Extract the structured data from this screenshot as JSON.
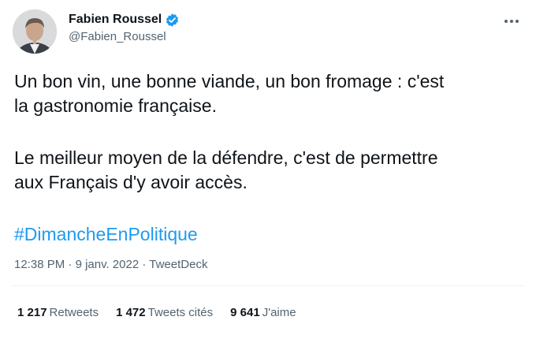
{
  "author": {
    "display_name": "Fabien Roussel",
    "handle": "@Fabien_Roussel",
    "verified": true,
    "verified_color": "#1d9bf0"
  },
  "icons": {
    "verified": "verified-badge-icon",
    "more": "more-options-icon"
  },
  "tweet": {
    "line1": "Un bon vin, une bonne viande, un bon fromage : c'est",
    "line2": "la gastronomie française.",
    "line3": "Le meilleur moyen de la défendre, c'est de permettre",
    "line4": "aux Français d'y avoir accès.",
    "hashtag": "#DimancheEnPolitique"
  },
  "meta": {
    "time": "12:38 PM",
    "date": "9 janv. 2022",
    "source": "TweetDeck"
  },
  "stats": {
    "retweets_count": "1 217",
    "retweets_label": "Retweets",
    "quotes_count": "1 472",
    "quotes_label": "Tweets cités",
    "likes_count": "9 641",
    "likes_label": "J'aime"
  },
  "colors": {
    "link": "#1d9bf0",
    "text": "#0f1419",
    "secondary": "#536471"
  }
}
